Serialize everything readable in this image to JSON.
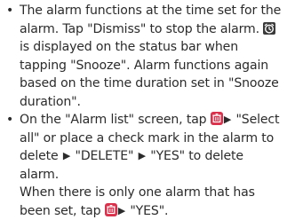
{
  "items": [
    {
      "text_1": "The alarm functions at the time set for the alarm. Tap \"Dismiss\" to stop the alarm. ",
      "icon_1": "alarm-snooze-icon",
      "text_2": " is displayed on the status bar when tapping \"Snooze\". Alarm functions again based on the time duration set in \"Snooze duration\"."
    },
    {
      "text_1": "On the \"Alarm list\" screen, tap ",
      "icon_1": "menu-icon",
      "arrow": "▶",
      "text_2": " \"Select all\" or place a check mark in the alarm to delete ",
      "text_3": " \"DELETE\" ",
      "text_4": " \"YES\" to delete alarm.",
      "text_5": "When there is only one alarm that has been set, tap ",
      "text_6": " \"YES\"."
    }
  ],
  "bullet_glyph": "•",
  "colors": {
    "text": "#2b2b2b",
    "menu_icon_bg": "#d9304b",
    "alarm_icon_bg": "#3a3a3a"
  }
}
